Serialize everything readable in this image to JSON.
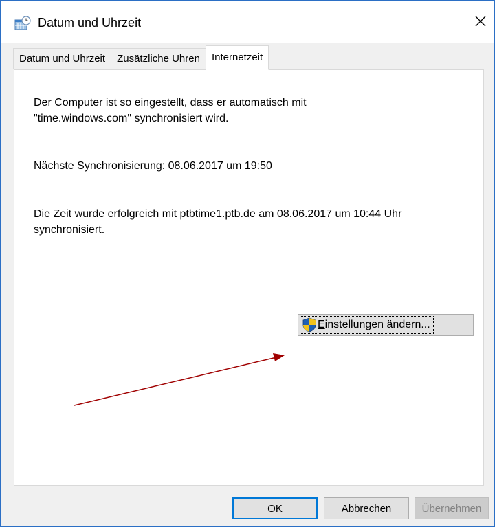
{
  "window": {
    "title": "Datum und Uhrzeit"
  },
  "tabs": [
    {
      "label": "Datum und Uhrzeit",
      "active": false
    },
    {
      "label": "Zusätzliche Uhren",
      "active": false
    },
    {
      "label": "Internetzeit",
      "active": true
    }
  ],
  "panel": {
    "line1": "Der Computer ist so eingestellt, dass er automatisch mit",
    "line2": "\"time.windows.com\" synchronisiert wird.",
    "next_sync": "Nächste Synchronisierung: 08.06.2017 um 19:50",
    "result_line1": "Die Zeit wurde erfolgreich mit ptbtime1.ptb.de am 08.06.2017 um 10:44 Uhr",
    "result_line2": "synchronisiert.",
    "settings_mnemonic": "E",
    "settings_rest": "instellungen ändern..."
  },
  "footer": {
    "ok": "OK",
    "cancel": "Abbrechen",
    "apply_mnemonic": "Ü",
    "apply_rest": "bernehmen"
  },
  "colors": {
    "window_border": "#2b6fc5",
    "annotation_arrow": "#a00000",
    "default_button_border": "#0078d7",
    "disabled_text": "#838383"
  },
  "icons": {
    "title": "clock-calendar-icon",
    "close": "close-icon",
    "settings": "uac-shield-icon"
  }
}
